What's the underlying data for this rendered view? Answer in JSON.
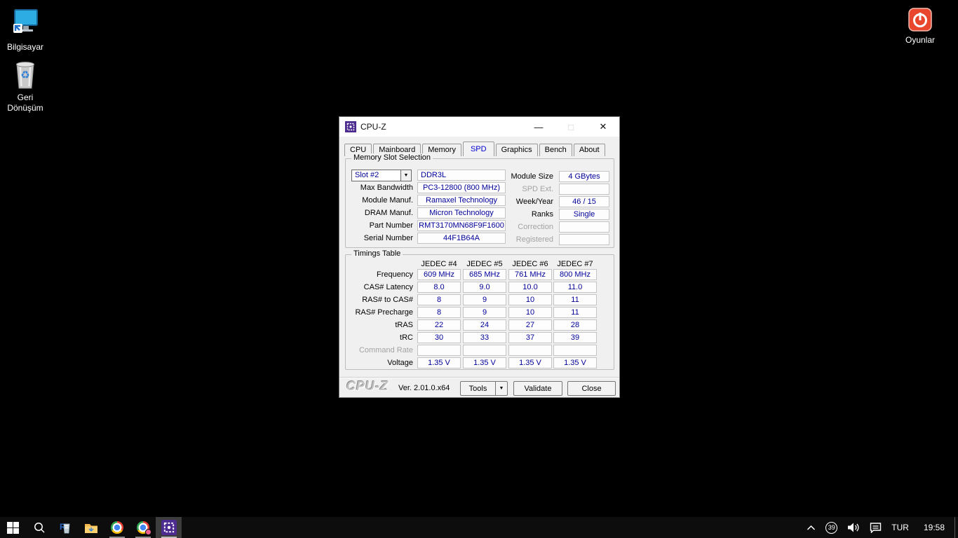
{
  "desktop": {
    "icons": [
      {
        "name": "computer",
        "label": "Bilgisayar"
      },
      {
        "name": "recycle-bin",
        "label": "Geri Dönüşüm"
      },
      {
        "name": "oyunlar",
        "label": "Oyunlar"
      }
    ]
  },
  "cpuz": {
    "title": "CPU-Z",
    "tabs": [
      "CPU",
      "Mainboard",
      "Memory",
      "SPD",
      "Graphics",
      "Bench",
      "About"
    ],
    "selected_tab": "SPD",
    "memory_slot": {
      "group_title": "Memory Slot Selection",
      "slot_select": "Slot #2",
      "memory_type": "DDR3L",
      "fields_left": [
        {
          "label": "Max Bandwidth",
          "value": "PC3-12800 (800 MHz)"
        },
        {
          "label": "Module Manuf.",
          "value": "Ramaxel Technology"
        },
        {
          "label": "DRAM Manuf.",
          "value": "Micron Technology"
        },
        {
          "label": "Part Number",
          "value": "RMT3170MN68F9F1600"
        },
        {
          "label": "Serial Number",
          "value": "44F1B64A"
        }
      ],
      "fields_right": [
        {
          "label": "Module Size",
          "value": "4 GBytes",
          "disabled": false
        },
        {
          "label": "SPD Ext.",
          "value": "",
          "disabled": true
        },
        {
          "label": "Week/Year",
          "value": "46 / 15",
          "disabled": false
        },
        {
          "label": "Ranks",
          "value": "Single",
          "disabled": false
        },
        {
          "label": "Correction",
          "value": "",
          "disabled": true
        },
        {
          "label": "Registered",
          "value": "",
          "disabled": true
        }
      ]
    },
    "timings": {
      "group_title": "Timings Table",
      "columns": [
        "JEDEC #4",
        "JEDEC #5",
        "JEDEC #6",
        "JEDEC #7"
      ],
      "rows": [
        {
          "label": "Frequency",
          "values": [
            "609 MHz",
            "685 MHz",
            "761 MHz",
            "800 MHz"
          ],
          "disabled": false
        },
        {
          "label": "CAS# Latency",
          "values": [
            "8.0",
            "9.0",
            "10.0",
            "11.0"
          ],
          "disabled": false
        },
        {
          "label": "RAS# to CAS#",
          "values": [
            "8",
            "9",
            "10",
            "11"
          ],
          "disabled": false
        },
        {
          "label": "RAS# Precharge",
          "values": [
            "8",
            "9",
            "10",
            "11"
          ],
          "disabled": false
        },
        {
          "label": "tRAS",
          "values": [
            "22",
            "24",
            "27",
            "28"
          ],
          "disabled": false
        },
        {
          "label": "tRC",
          "values": [
            "30",
            "33",
            "37",
            "39"
          ],
          "disabled": false
        },
        {
          "label": "Command Rate",
          "values": [
            "",
            "",
            "",
            ""
          ],
          "disabled": true
        },
        {
          "label": "Voltage",
          "values": [
            "1.35 V",
            "1.35 V",
            "1.35 V",
            "1.35 V"
          ],
          "disabled": false
        }
      ]
    },
    "footer": {
      "logo": "CPU-Z",
      "version": "Ver. 2.01.0.x64",
      "tools_label": "Tools",
      "validate_label": "Validate",
      "close_label": "Close"
    }
  },
  "taskbar": {
    "app_icons": [
      "start",
      "search",
      "app-r-glass",
      "file-explorer",
      "chrome",
      "chrome-profile",
      "cpu-z"
    ],
    "tray": {
      "badge": "39",
      "language": "TUR",
      "time": "19:58"
    }
  },
  "colors": {
    "value_text": "#000099",
    "selected_tab_text": "#0000d4",
    "cpuz_purple": "#4d2c91",
    "taskbar_bg": "#0d0d0d",
    "dialog_bg": "#f0f0f0",
    "oyunlar_red": "#e8472e"
  }
}
